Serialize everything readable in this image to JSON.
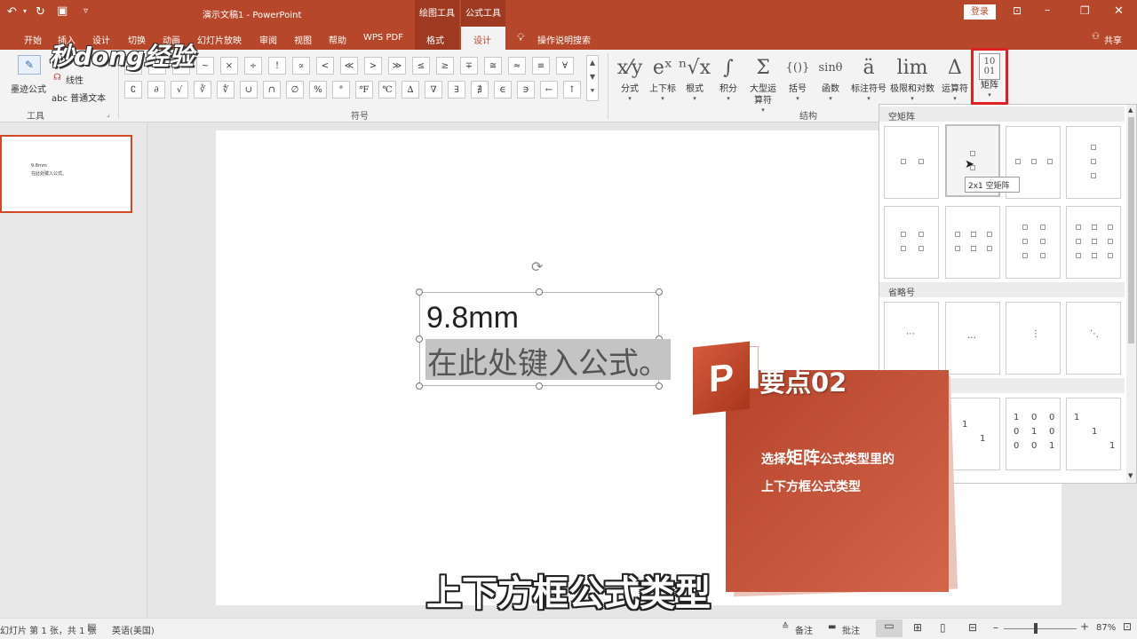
{
  "window": {
    "doc_title": "演示文稿1 - PowerPoint",
    "context_tab_drawing": "绘图工具",
    "context_tab_equation": "公式工具",
    "login": "登录",
    "share": "共享",
    "tell_me": "操作说明搜索"
  },
  "tabs": [
    "开始",
    "插入",
    "设计",
    "切换",
    "动画",
    "幻灯片放映",
    "审阅",
    "视图",
    "帮助",
    "WPS PDF",
    "格式",
    "设计"
  ],
  "ribbon": {
    "tools": {
      "ink_equation": "墨迹公式",
      "linear": "线性",
      "normal_text": "abc 普通文本",
      "group_label": "工具"
    },
    "symbols": {
      "group_label": "符号",
      "row1": [
        "∞",
        "=",
        "≠",
        "~",
        "×",
        "÷",
        "!",
        "∝",
        "<",
        "≪",
        ">",
        "≫",
        "≤",
        "≥",
        "∓",
        "≅",
        "≈",
        "≡",
        "∀"
      ],
      "row2": [
        "∁",
        "∂",
        "√",
        "∛",
        "∜",
        "∪",
        "∩",
        "∅",
        "%",
        "°",
        "℉",
        "℃",
        "∆",
        "∇",
        "∃",
        "∄",
        "∈",
        "∋",
        "←",
        "↑"
      ]
    },
    "structures": {
      "group_label": "结构",
      "items": [
        {
          "label": "分式",
          "glyph": "x⁄y"
        },
        {
          "label": "上下标",
          "glyph": "eˣ"
        },
        {
          "label": "根式",
          "glyph": "ⁿ√x"
        },
        {
          "label": "积分",
          "glyph": "∫"
        },
        {
          "label": "大型运算符",
          "glyph": "Σ"
        },
        {
          "label": "括号",
          "glyph": "{()}"
        },
        {
          "label": "函数",
          "glyph": "sinθ"
        },
        {
          "label": "标注符号",
          "glyph": "ä"
        },
        {
          "label": "极限和对数",
          "glyph": "lim"
        },
        {
          "label": "运算符",
          "glyph": "Δ"
        },
        {
          "label": "矩阵",
          "glyph": "10 01"
        }
      ]
    }
  },
  "slide": {
    "thumb_line1": "9.8mm",
    "thumb_line2": "在此处键入公式。",
    "line1": "9.8mm",
    "line2": "在此处键入公式。"
  },
  "gallery": {
    "section_empty": "空矩阵",
    "section_dots": "省略号",
    "tooltip": "2x1 空矩阵",
    "dots_glyphs": [
      "⋯",
      "…",
      "⋮",
      "⋱"
    ],
    "identity2_sparse": [
      "1",
      "1"
    ],
    "identity3": [
      "1",
      "0",
      "0",
      "0",
      "1",
      "0",
      "0",
      "0",
      "1"
    ],
    "identity3_sparse": [
      "1",
      "1",
      "1"
    ]
  },
  "watermark": {
    "text": "秒dong经验"
  },
  "overlay": {
    "badge_title": "要点02",
    "desc_pre": "选择",
    "desc_em": "矩阵",
    "desc_post": "公式类型里的",
    "desc_line2": "上下方框公式类型",
    "subtitle": "上下方框公式类型"
  },
  "statusbar": {
    "slide_info": "幻灯片 第 1 张，共 1 张",
    "language": "英语(美国)",
    "notes": "备注",
    "comments": "批注",
    "zoom": "87%"
  },
  "colors": {
    "brand": "#b7472a",
    "accent_overlay": "#c9573d",
    "highlight_box": "#e02020"
  }
}
